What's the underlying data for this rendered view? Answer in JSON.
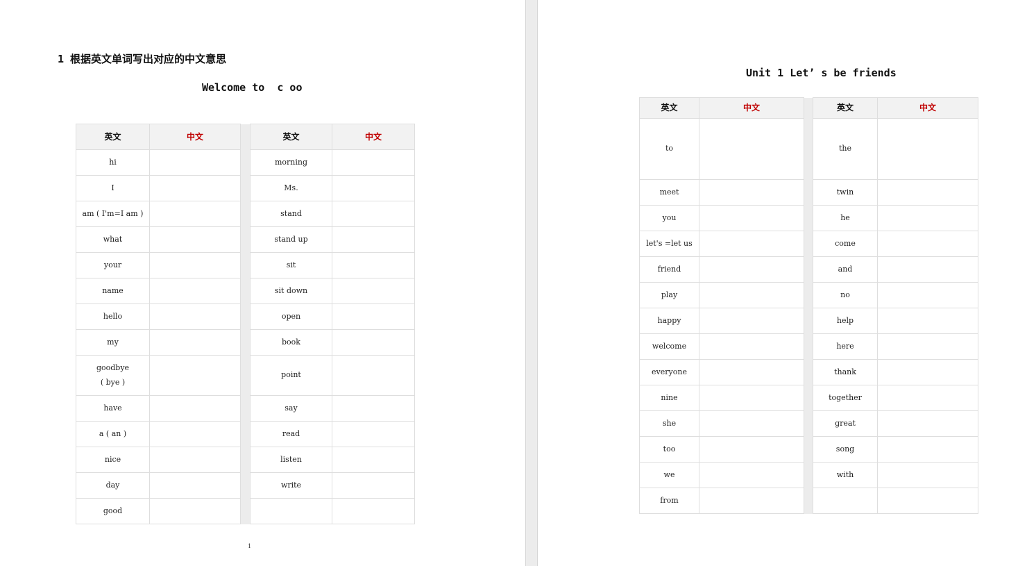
{
  "left_page": {
    "heading": "1 根据英文单词写出对应的中文意思",
    "subtitle": "Welcome to  c oo",
    "header": {
      "en": "英文",
      "zh": "中文"
    },
    "rows": [
      {
        "a": "hi",
        "b": "morning"
      },
      {
        "a": "I",
        "b": "Ms."
      },
      {
        "a": "am ( I'm=I am )",
        "b": "stand"
      },
      {
        "a": "what",
        "b": "stand up"
      },
      {
        "a": "your",
        "b": "sit"
      },
      {
        "a": "name",
        "b": "sit down"
      },
      {
        "a": "hello",
        "b": "open"
      },
      {
        "a": "my",
        "b": "book"
      },
      {
        "a": "goodbye\n( bye )",
        "b": "point"
      },
      {
        "a": "have",
        "b": "say"
      },
      {
        "a": "a ( an )",
        "b": "read"
      },
      {
        "a": "nice",
        "b": "listen"
      },
      {
        "a": "day",
        "b": "write"
      },
      {
        "a": "good",
        "b": ""
      }
    ],
    "page_number": "1"
  },
  "right_page": {
    "subtitle": "Unit 1 Let’ s be friends",
    "header": {
      "en": "英文",
      "zh": "中文"
    },
    "rows": [
      {
        "a": "to",
        "b": "the"
      },
      {
        "a": "meet",
        "b": "twin"
      },
      {
        "a": "you",
        "b": "he"
      },
      {
        "a": "let's =let us",
        "b": "come"
      },
      {
        "a": "friend",
        "b": "and"
      },
      {
        "a": "play",
        "b": "no"
      },
      {
        "a": "happy",
        "b": "help"
      },
      {
        "a": "welcome",
        "b": "here"
      },
      {
        "a": "everyone",
        "b": "thank"
      },
      {
        "a": "nine",
        "b": "together"
      },
      {
        "a": "she",
        "b": "great"
      },
      {
        "a": "too",
        "b": "song"
      },
      {
        "a": "we",
        "b": "with"
      },
      {
        "a": "from",
        "b": ""
      }
    ]
  }
}
